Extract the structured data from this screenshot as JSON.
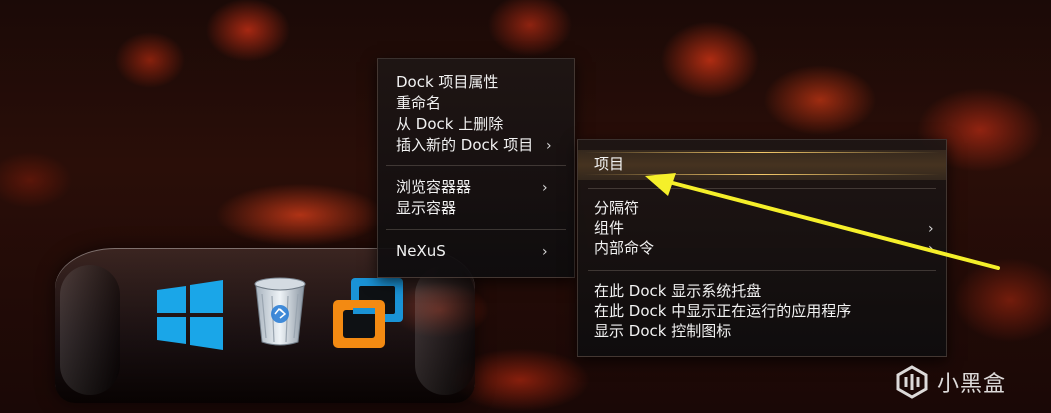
{
  "main_menu": {
    "items": [
      {
        "label": "Dock 项目属性"
      },
      {
        "label": "重命名"
      },
      {
        "label": "从 Dock 上删除"
      },
      {
        "label": "插入新的 Dock 项目",
        "has_submenu": true
      },
      {
        "label": "浏览容器器",
        "has_submenu": true
      },
      {
        "label": "显示容器"
      },
      {
        "label": "NeXuS",
        "has_submenu": true
      }
    ]
  },
  "sub_menu": {
    "items": [
      {
        "label": "项目",
        "highlighted": true
      },
      {
        "label": "分隔符"
      },
      {
        "label": "组件",
        "has_submenu": true
      },
      {
        "label": "内部命令",
        "has_submenu": true
      },
      {
        "label": "在此 Dock 显示系统托盘"
      },
      {
        "label": "在此 Dock 中显示正在运行的应用程序"
      },
      {
        "label": "显示 Dock 控制图标"
      }
    ]
  },
  "dock": {
    "icons": [
      "windows-logo-icon",
      "recycle-bin-icon",
      "virtualbox-icon"
    ]
  },
  "annotation": {
    "color": "#f5ef2a"
  },
  "watermark": {
    "text": "小黑盒"
  },
  "colors": {
    "menu_text": "#f2f2f2",
    "highlight_line": "#ffd26e",
    "arrow": "#f5ef2a"
  }
}
